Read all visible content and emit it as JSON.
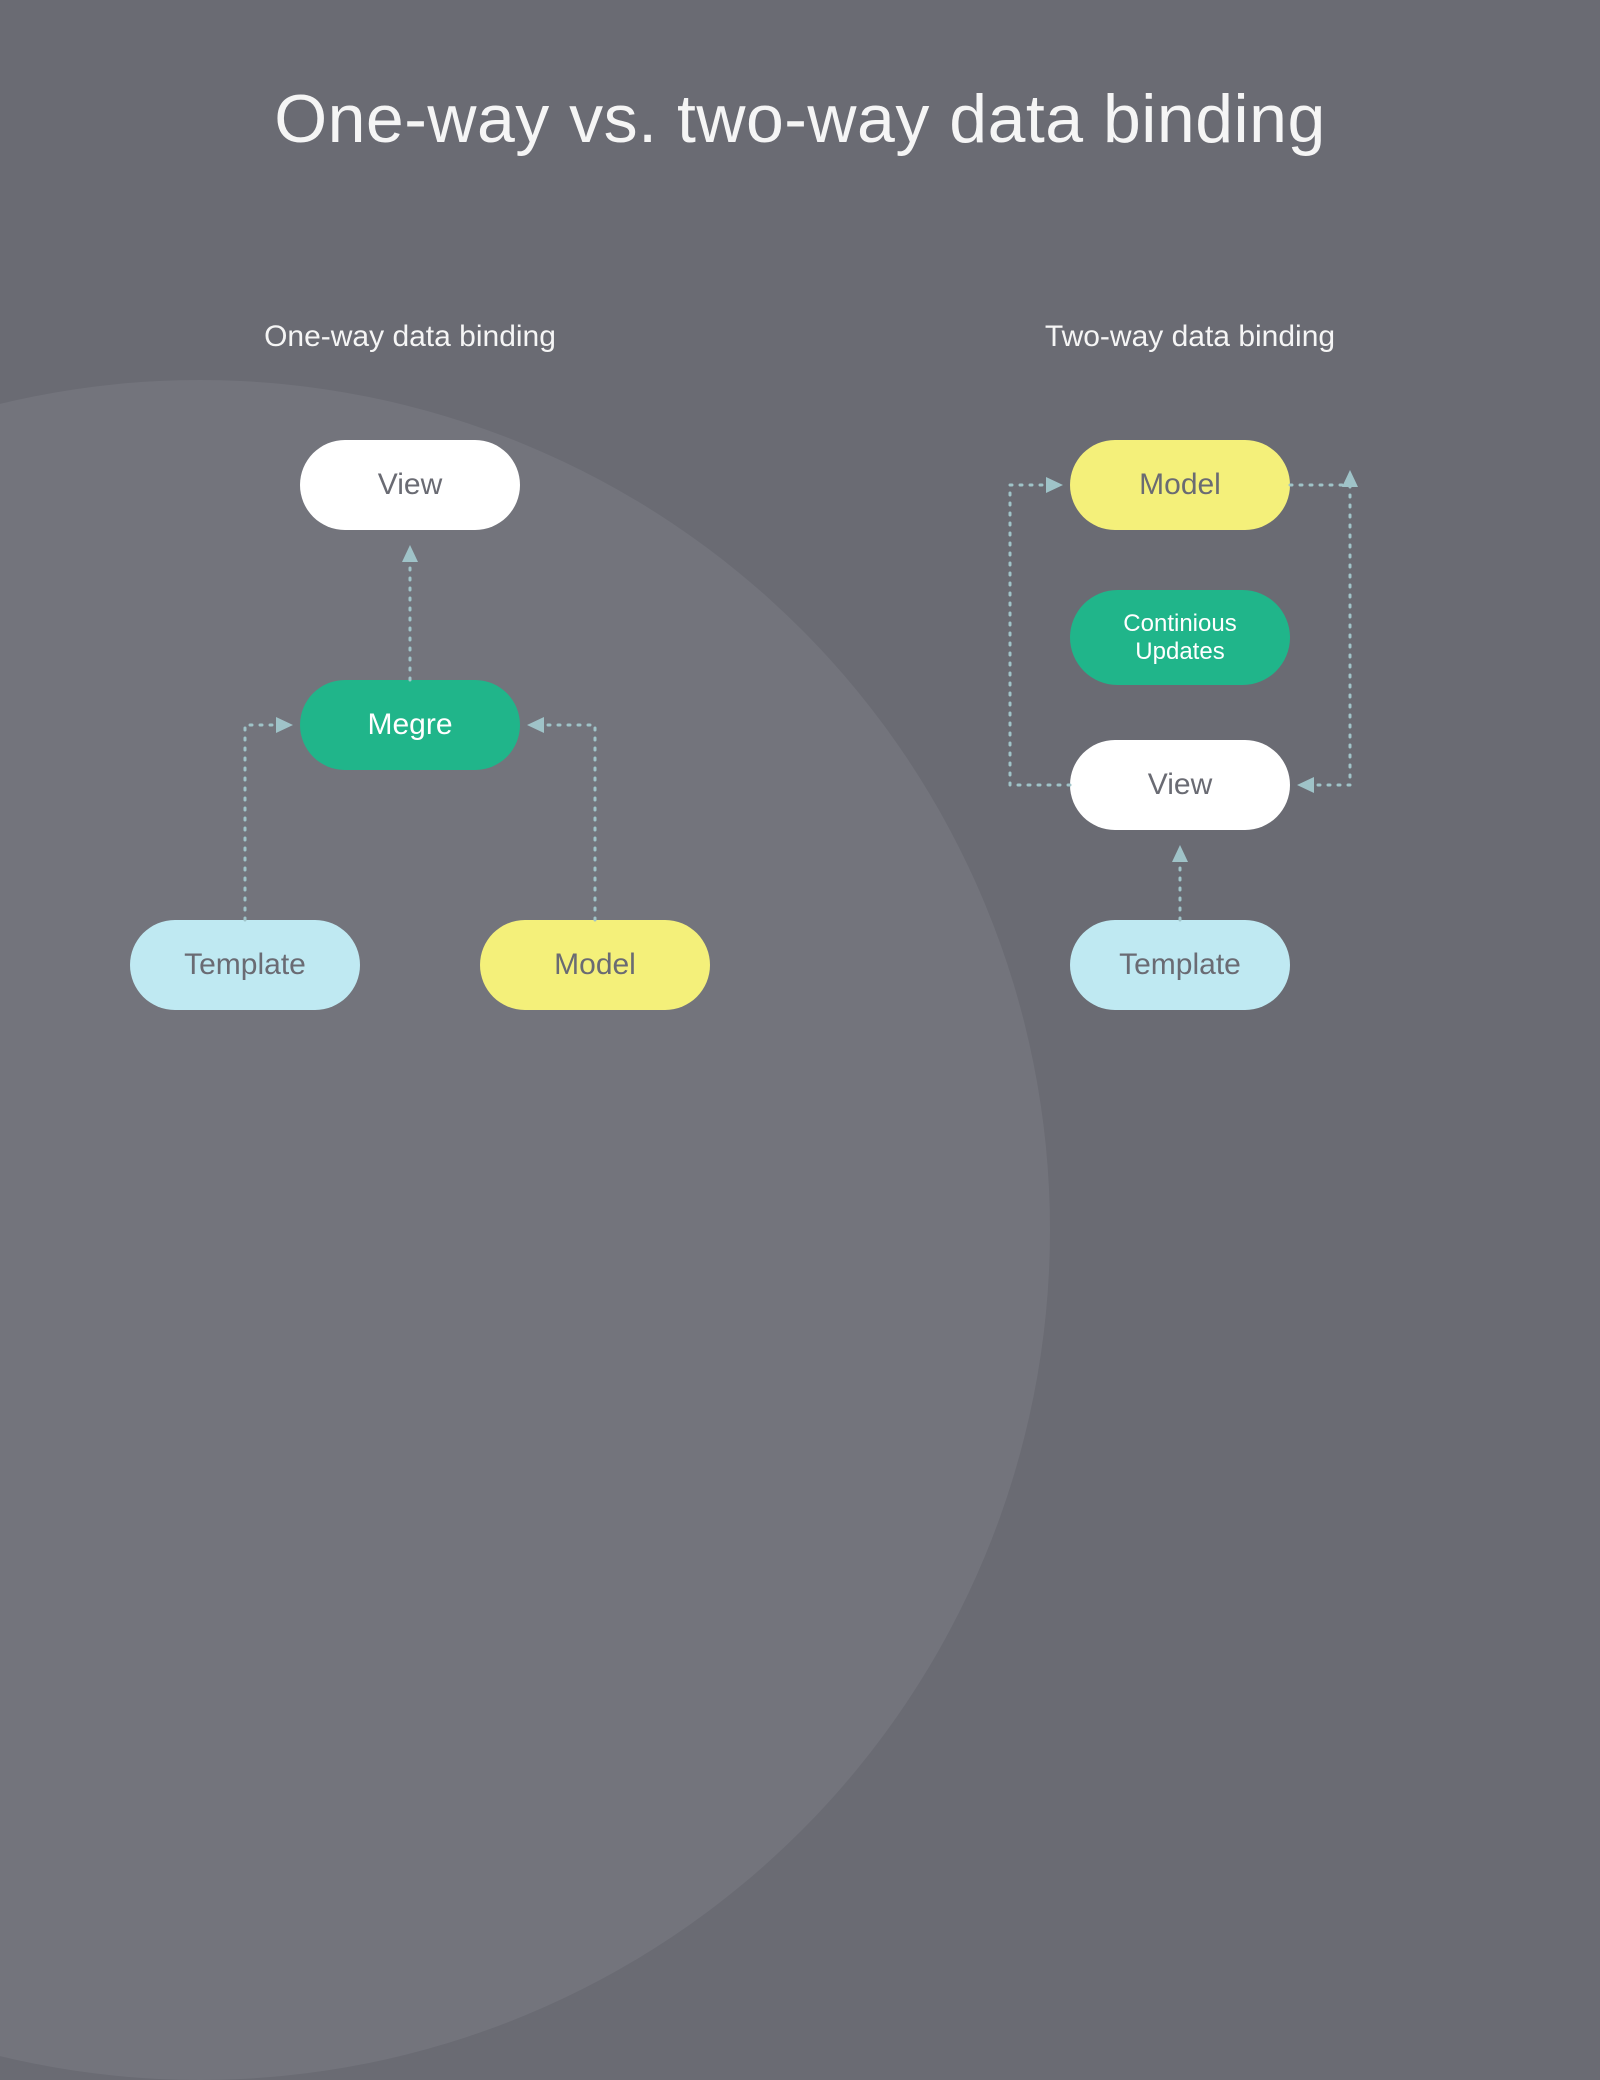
{
  "title": "One-way vs. two-way data binding",
  "left": {
    "heading": "One-way data binding",
    "nodes": {
      "view": "View",
      "merge": "Megre",
      "template": "Template",
      "model": "Model"
    }
  },
  "right": {
    "heading": "Two-way data binding",
    "nodes": {
      "model": "Model",
      "updates": "Continious Updates",
      "view": "View",
      "template": "Template"
    }
  },
  "colors": {
    "background": "#6a6b73",
    "backgroundCircle": "#73747c",
    "white": "#ffffff",
    "green": "#20b58a",
    "yellow": "#f4f07a",
    "cyan": "#bfe9f2",
    "connector": "#9fc3c8"
  }
}
